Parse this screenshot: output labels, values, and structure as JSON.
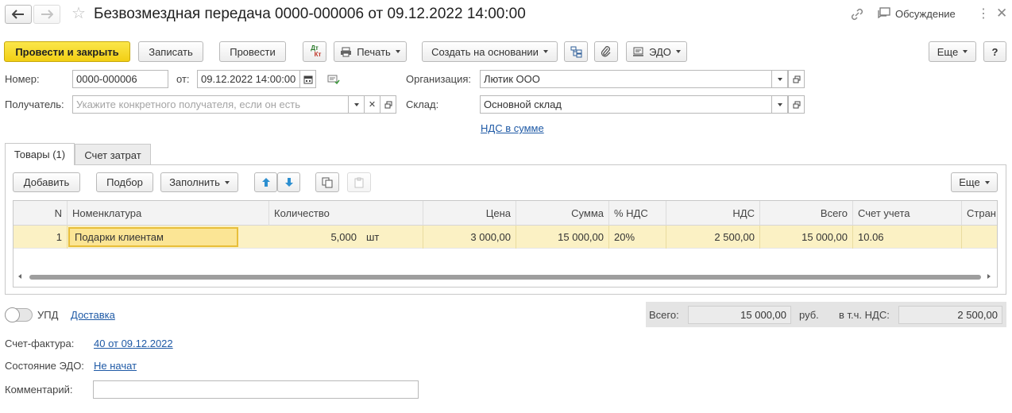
{
  "title": "Безвозмездная передача 0000-000006 от 09.12.2022 14:00:00",
  "topbar": {
    "discussion": "Обсуждение"
  },
  "toolbar": {
    "post_close": "Провести и закрыть",
    "save": "Записать",
    "post": "Провести",
    "dtkt_top": "Дт",
    "dtkt_bottom": "Кт",
    "print": "Печать",
    "create_based": "Создать на основании",
    "edo": "ЭДО",
    "more": "Еще",
    "help": "?"
  },
  "form": {
    "number_label": "Номер:",
    "number_value": "0000-000006",
    "date_label": "от:",
    "date_value": "09.12.2022 14:00:00",
    "org_label": "Организация:",
    "org_value": "Лютик ООО",
    "recipient_label": "Получатель:",
    "recipient_placeholder": "Укажите конкретного получателя, если он есть",
    "warehouse_label": "Склад:",
    "warehouse_value": "Основной склад",
    "vat_link": "НДС в сумме"
  },
  "tabs": [
    {
      "label": "Товары (1)",
      "active": true
    },
    {
      "label": "Счет затрат",
      "active": false
    }
  ],
  "table_toolbar": {
    "add": "Добавить",
    "pick": "Подбор",
    "fill": "Заполнить",
    "more": "Еще"
  },
  "table": {
    "columns": [
      "N",
      "Номенклатура",
      "Количество",
      "Цена",
      "Сумма",
      "% НДС",
      "НДС",
      "Всего",
      "Счет учета",
      "Стран"
    ],
    "rows": [
      {
        "n": "1",
        "item": "Подарки клиентам",
        "qty": "5,000",
        "unit": "шт",
        "price": "3 000,00",
        "sum": "15 000,00",
        "vat_rate": "20%",
        "vat": "2 500,00",
        "total": "15 000,00",
        "account": "10.06",
        "country": ""
      }
    ]
  },
  "footer": {
    "upd_label": "УПД",
    "delivery_link": "Доставка",
    "total_label": "Всего:",
    "total_value": "15 000,00",
    "currency": "руб.",
    "vat_incl_label": "в т.ч. НДС:",
    "vat_incl_value": "2 500,00",
    "invoice_label": "Счет-фактура:",
    "invoice_link": "40 от 09.12.2022",
    "edo_state_label": "Состояние ЭДО:",
    "edo_state_link": "Не начат",
    "comment_label": "Комментарий:",
    "comment_value": ""
  }
}
